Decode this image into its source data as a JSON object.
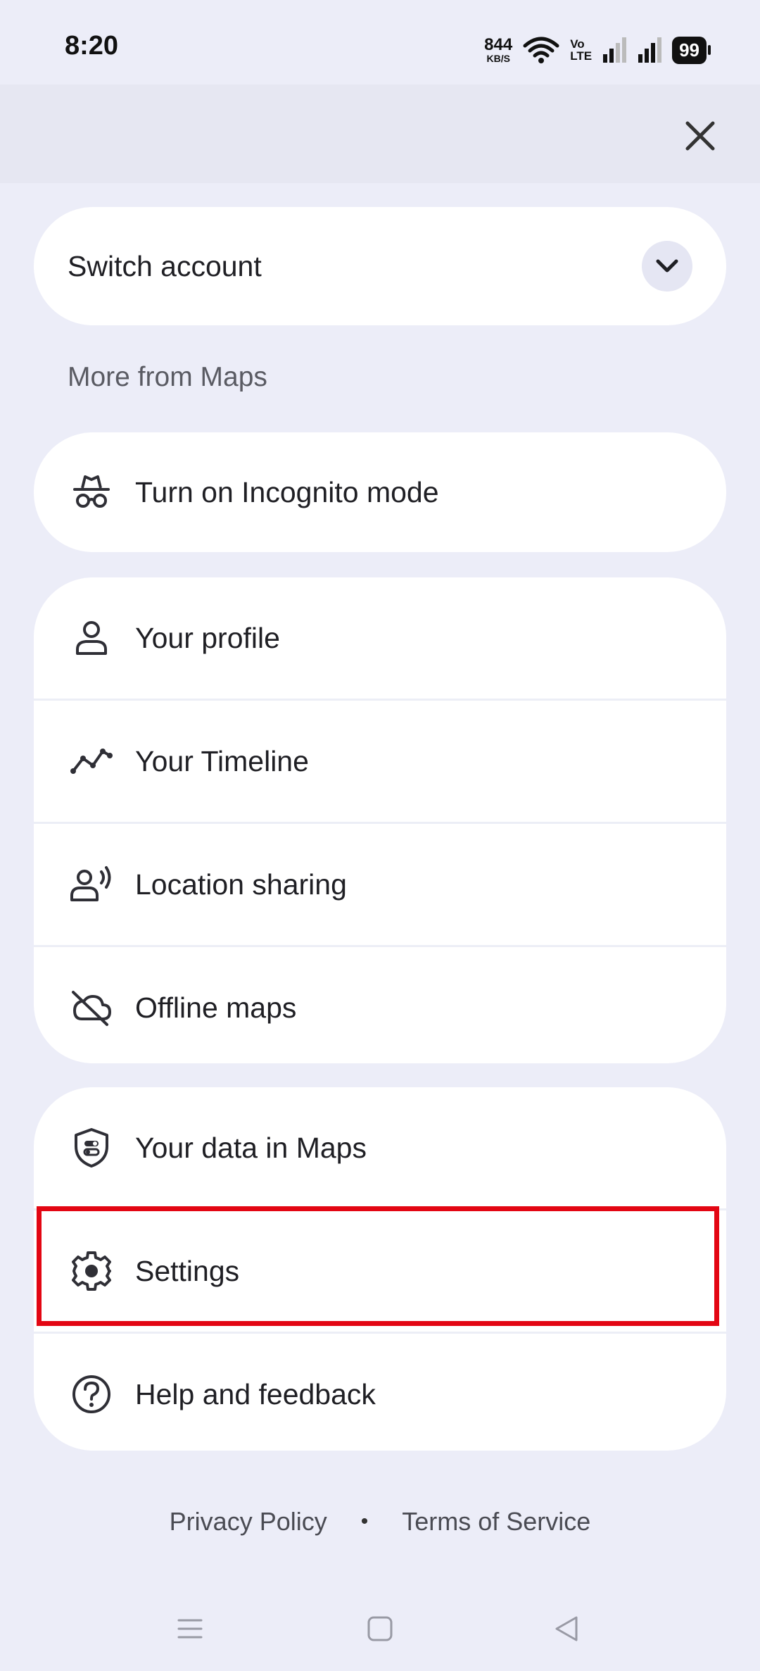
{
  "status_bar": {
    "time": "8:20",
    "net_speed_value": "844",
    "net_speed_unit": "KB/S",
    "volte_top": "Vo",
    "volte_bottom": "LTE",
    "battery": "99"
  },
  "switch_account": {
    "label": "Switch account"
  },
  "section_title": "More from Maps",
  "incognito": {
    "label": "Turn on Incognito mode",
    "icon": "incognito-icon"
  },
  "group1": [
    {
      "label": "Your profile",
      "icon": "person-icon"
    },
    {
      "label": "Your Timeline",
      "icon": "timeline-icon"
    },
    {
      "label": "Location sharing",
      "icon": "location-sharing-icon"
    },
    {
      "label": "Offline maps",
      "icon": "cloud-off-icon"
    }
  ],
  "group2": [
    {
      "label": "Your data in Maps",
      "icon": "shield-data-icon"
    },
    {
      "label": "Settings",
      "icon": "gear-icon"
    },
    {
      "label": "Help and feedback",
      "icon": "help-icon"
    }
  ],
  "footer": {
    "privacy": "Privacy Policy",
    "separator": "•",
    "terms": "Terms of Service"
  },
  "colors": {
    "background": "#ecedf8",
    "card": "#ffffff",
    "highlight": "#e30613",
    "text": "#1f1f24"
  }
}
